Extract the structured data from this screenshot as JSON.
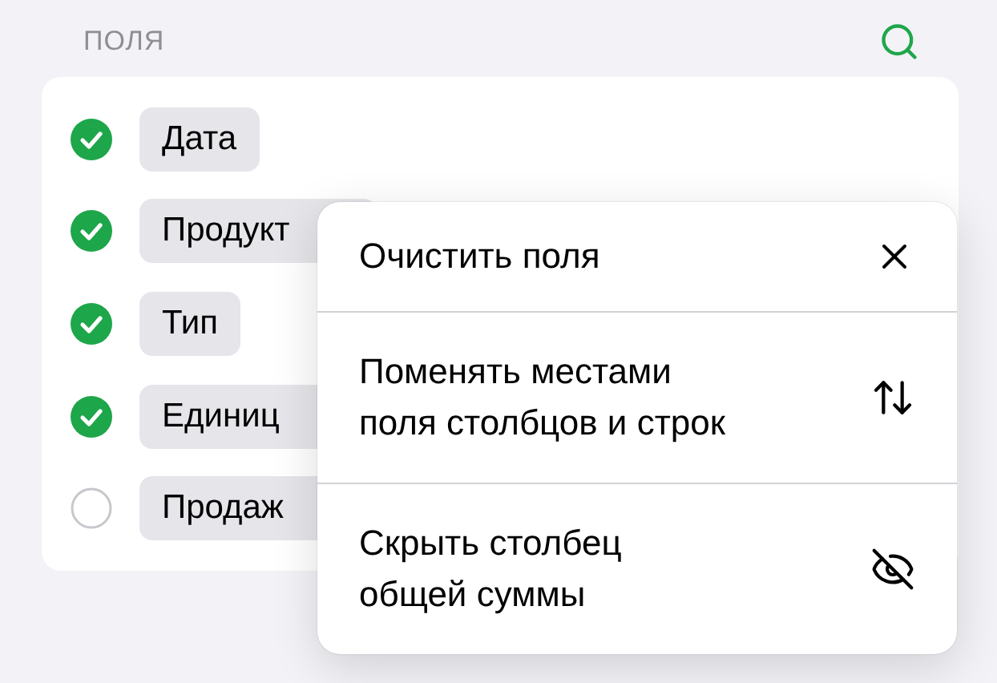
{
  "header": {
    "title": "ПОЛЯ"
  },
  "fields": [
    {
      "label": "Дата",
      "checked": true
    },
    {
      "label": "Продукт",
      "checked": true
    },
    {
      "label": "Тип",
      "checked": true
    },
    {
      "label": "Единиц",
      "checked": true
    },
    {
      "label": "Продаж",
      "checked": false
    }
  ],
  "menu": [
    {
      "kind": "clear",
      "lines": [
        "Очистить поля"
      ]
    },
    {
      "kind": "swap",
      "lines": [
        "Поменять местами",
        "поля столбцов и строк"
      ]
    },
    {
      "kind": "hide",
      "lines": [
        "Скрыть столбец",
        "общей суммы"
      ]
    }
  ]
}
